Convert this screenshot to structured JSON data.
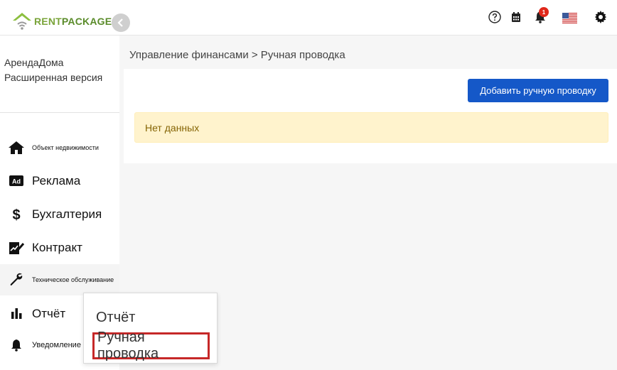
{
  "header": {
    "logo": {
      "rent": "RENT",
      "package": "PACKAGE"
    },
    "notification_count": "1",
    "icons": [
      "help-icon",
      "calendar-icon",
      "bell-icon",
      "us-flag-icon",
      "gear-icon"
    ]
  },
  "sidebar": {
    "account_name": "АрендаДома",
    "account_plan": "Расширенная версия",
    "items": [
      {
        "label": "Объект недвижимости",
        "icon": "home-icon"
      },
      {
        "label": "Реклама",
        "icon": "ad-icon"
      },
      {
        "label": "Бухгалтерия",
        "icon": "dollar-icon"
      },
      {
        "label": "Контракт",
        "icon": "contract-icon"
      },
      {
        "label": "Техническое обслуживание",
        "icon": "wrench-icon"
      },
      {
        "label": "Отчёт",
        "icon": "bar-chart-icon"
      },
      {
        "label": "Уведомление",
        "icon": "bell-icon"
      }
    ]
  },
  "main": {
    "breadcrumb": "Управление финансами > Ручная проводка",
    "add_button": "Добавить ручную проводку",
    "empty_message": "Нет данных"
  },
  "popup": {
    "items": [
      "Отчёт",
      "Ручная проводка"
    ]
  },
  "colors": {
    "primary": "#1558c8",
    "alert_bg": "#fff3cd",
    "alert_text": "#856404",
    "highlight": "#c62828",
    "logo_green": "#7aa43a"
  }
}
